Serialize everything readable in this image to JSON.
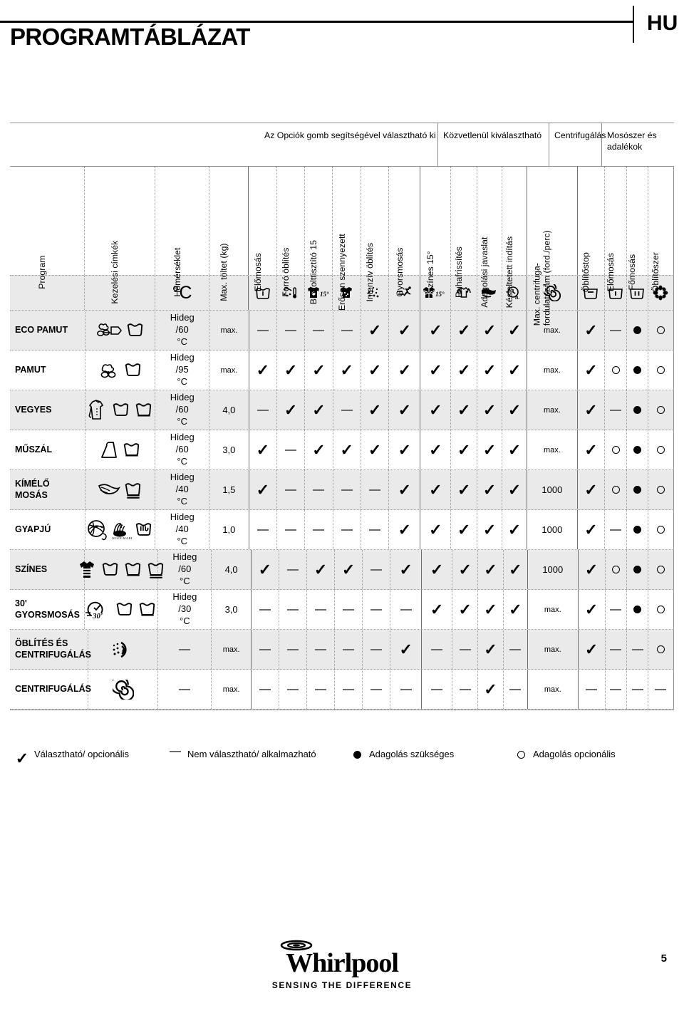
{
  "header": {
    "title": "PROGRAMTÁBLÁZAT",
    "language": "HU"
  },
  "table": {
    "group_headers": [
      {
        "label": "Az Opciók gomb segítségével választható ki"
      },
      {
        "label": "Közvetlenül kiválasztható"
      },
      {
        "label": "Centrifugálás"
      },
      {
        "label": "Mosószer és adalékok"
      }
    ],
    "columns": [
      {
        "key": "program",
        "label": "Program",
        "icon": ""
      },
      {
        "key": "labels",
        "label": "Kezelési címkék",
        "icon": ""
      },
      {
        "key": "temp",
        "label": "Hőmérséklet",
        "icon": "°C"
      },
      {
        "key": "load",
        "label": "Max. töltet (kg)",
        "icon": ""
      },
      {
        "key": "prewash",
        "label": "Előmosás",
        "icon": "prewash-tub-icon"
      },
      {
        "key": "hotrinse",
        "label": "Forró öblítés",
        "icon": "hot-rinse-icon"
      },
      {
        "key": "biostain",
        "label": "Bio folttisztító 15",
        "icon": "bio-stain-15-icon"
      },
      {
        "key": "heavysoil",
        "label": "Erősen szennyezett",
        "icon": "heavy-soil-shirt-icon"
      },
      {
        "key": "intrinse",
        "label": "Intenzív öblítés",
        "icon": "intensive-rinse-icon"
      },
      {
        "key": "quickwash",
        "label": "Gyorsmosás",
        "icon": "quick-wash-runner-icon"
      },
      {
        "key": "colors15",
        "label": "Színes 15°",
        "icon": "colours-15-icon"
      },
      {
        "key": "refresh",
        "label": "Ruhafrissítés",
        "icon": "refresh-shirt-icon"
      },
      {
        "key": "dosing",
        "label": "Adagolási javaslat",
        "icon": "dosing-hand-icon"
      },
      {
        "key": "delay",
        "label": "Késleltetett indítás",
        "icon": "delay-clock-icon"
      },
      {
        "key": "spinspeed",
        "label": "Max. centrifuga-fordulatszám (ford./perc)",
        "icon": "spin-spiral-icon"
      },
      {
        "key": "rinsehold",
        "label": "Öblítőstop",
        "icon": "rinse-hold-tub-icon"
      },
      {
        "key": "predet",
        "label": "Előmosás",
        "icon": "prewash-compartment-icon"
      },
      {
        "key": "maindet",
        "label": "Főmosás",
        "icon": "main-wash-compartment-icon"
      },
      {
        "key": "softener",
        "label": "Öblítőszer",
        "icon": "softener-flower-icon"
      }
    ],
    "rows": [
      {
        "program": "ECO PAMUT",
        "care_icon": "eco-cotton-icon",
        "wash_symbols": [
          "tub"
        ],
        "temp": "Hideg /60 °C",
        "load": "max.",
        "marks": [
          "dash",
          "dash",
          "dash",
          "dash",
          "check",
          "check",
          "check",
          "check",
          "check",
          "check"
        ],
        "spin": "max.",
        "rinsehold": "check",
        "detergent": [
          "dash",
          "dot",
          "ring"
        ]
      },
      {
        "program": "PAMUT",
        "care_icon": "cotton-icon",
        "wash_symbols": [
          "tub"
        ],
        "temp": "Hideg /95 °C",
        "load": "max.",
        "marks": [
          "check",
          "check",
          "check",
          "check",
          "check",
          "check",
          "check",
          "check",
          "check",
          "check"
        ],
        "spin": "max.",
        "rinsehold": "check",
        "detergent": [
          "ring",
          "dot",
          "ring"
        ]
      },
      {
        "program": "VEGYES",
        "care_icon": "mixed-shirt-icon",
        "wash_symbols": [
          "tub",
          "tub-bar"
        ],
        "temp": "Hideg /60 °C",
        "load": "4,0",
        "marks": [
          "dash",
          "check",
          "check",
          "dash",
          "check",
          "check",
          "check",
          "check",
          "check",
          "check"
        ],
        "spin": "max.",
        "rinsehold": "check",
        "detergent": [
          "dash",
          "dot",
          "ring"
        ]
      },
      {
        "program": "MŰSZÁL",
        "care_icon": "synthetic-icon",
        "wash_symbols": [
          "tub-bar"
        ],
        "temp": "Hideg /60 °C",
        "load": "3,0",
        "marks": [
          "check",
          "dash",
          "check",
          "check",
          "check",
          "check",
          "check",
          "check",
          "check",
          "check"
        ],
        "spin": "max.",
        "rinsehold": "check",
        "detergent": [
          "ring",
          "dot",
          "ring"
        ]
      },
      {
        "program": "KÍMÉLŐ MOSÁS",
        "care_icon": "delicate-feather-icon",
        "wash_symbols": [
          "tub-bar2"
        ],
        "temp": "Hideg /40 °C",
        "load": "1,5",
        "marks": [
          "check",
          "dash",
          "dash",
          "dash",
          "dash",
          "check",
          "check",
          "check",
          "check",
          "check"
        ],
        "spin": "1000",
        "rinsehold": "check",
        "detergent": [
          "ring",
          "dot",
          "ring"
        ]
      },
      {
        "program": "GYAPJÚ",
        "care_icon": "wool-ball-icon",
        "wash_symbols": [
          "woolmark",
          "hand-wash-tub"
        ],
        "temp": "Hideg /40 °C",
        "load": "1,0",
        "marks": [
          "dash",
          "dash",
          "dash",
          "dash",
          "dash",
          "check",
          "check",
          "check",
          "check",
          "check"
        ],
        "spin": "1000",
        "rinsehold": "check",
        "detergent": [
          "dash",
          "dot",
          "ring"
        ]
      },
      {
        "program": "SZÍNES",
        "care_icon": "colours-shirt-icon",
        "wash_symbols": [
          "tub",
          "tub-bar",
          "tub-bar2"
        ],
        "temp": "Hideg /60 °C",
        "load": "4,0",
        "marks": [
          "check",
          "dash",
          "check",
          "check",
          "dash",
          "check",
          "check",
          "check",
          "check",
          "check"
        ],
        "spin": "1000",
        "rinsehold": "check",
        "detergent": [
          "ring",
          "dot",
          "ring"
        ]
      },
      {
        "program": "30' GYORSMOSÁS",
        "care_icon": "clock-30-icon",
        "wash_symbols": [
          "tub",
          "tub-bar"
        ],
        "temp": "Hideg /30 °C",
        "load": "3,0",
        "marks": [
          "dash",
          "dash",
          "dash",
          "dash",
          "dash",
          "dash",
          "check",
          "check",
          "check",
          "check"
        ],
        "spin": "max.",
        "rinsehold": "check",
        "detergent": [
          "dash",
          "dot",
          "ring"
        ]
      },
      {
        "program": "ÖBLÍTÉS ÉS CENTRIFUGÁLÁS",
        "care_icon": "rinse-spin-icon",
        "wash_symbols": [],
        "temp": "—",
        "load": "max.",
        "marks": [
          "dash",
          "dash",
          "dash",
          "dash",
          "dash",
          "check",
          "dash",
          "dash",
          "check",
          "dash"
        ],
        "spin": "max.",
        "rinsehold": "check",
        "detergent": [
          "dash",
          "dash",
          "ring"
        ]
      },
      {
        "program": "CENTRIFUGÁLÁS",
        "care_icon": "spin-only-icon",
        "wash_symbols": [],
        "temp": "—",
        "load": "max.",
        "marks": [
          "dash",
          "dash",
          "dash",
          "dash",
          "dash",
          "dash",
          "dash",
          "dash",
          "check",
          "dash"
        ],
        "spin": "max.",
        "rinsehold": "dash",
        "detergent": [
          "dash",
          "dash",
          "dash"
        ]
      }
    ],
    "row_first_cell_dash_note": {
      "ÖBLÍTÉS ÉS CENTRIFUGÁLÁS": "dash",
      "CENTRIFUGÁLÁS": "dash"
    }
  },
  "legend": [
    {
      "symbol": "check",
      "label": "Választható/ opcionális"
    },
    {
      "symbol": "dash",
      "label": "Nem választható/ alkalmazható"
    },
    {
      "symbol": "dot",
      "label": "Adagolás szükséges"
    },
    {
      "symbol": "ring",
      "label": "Adagolás opcionális"
    }
  ],
  "footer": {
    "brand": "Whirlpool",
    "tagline": "SENSING THE DIFFERENCE",
    "page_number": "5"
  }
}
